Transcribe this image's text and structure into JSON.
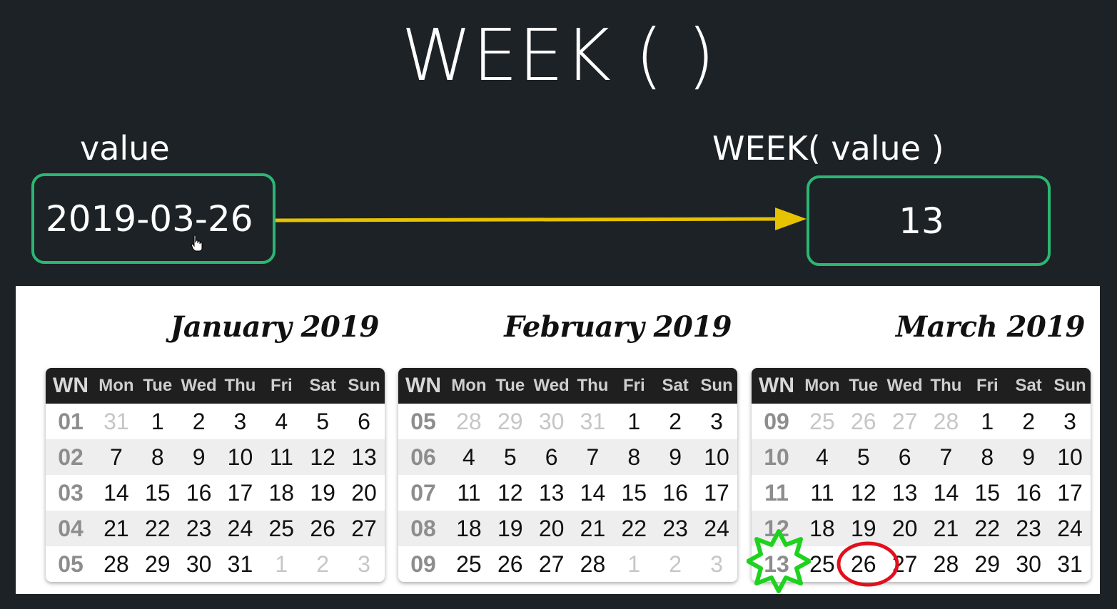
{
  "title": "WEEK ( )",
  "input": {
    "label": "value",
    "value": "2019-03-26"
  },
  "output": {
    "label": "WEEK( value )",
    "value": "13"
  },
  "colors": {
    "box_border": "#2bb673",
    "arrow": "#e6c200",
    "star": "#1ed21e",
    "circle": "#e0101c"
  },
  "calendar": {
    "headers": [
      "WN",
      "Mon",
      "Tue",
      "Wed",
      "Thu",
      "Fri",
      "Sat",
      "Sun"
    ],
    "months": [
      {
        "title": "January 2019",
        "weeks": [
          {
            "wn": "01",
            "days": [
              {
                "d": "31",
                "dim": true
              },
              {
                "d": "1"
              },
              {
                "d": "2"
              },
              {
                "d": "3"
              },
              {
                "d": "4"
              },
              {
                "d": "5"
              },
              {
                "d": "6"
              }
            ]
          },
          {
            "wn": "02",
            "days": [
              {
                "d": "7"
              },
              {
                "d": "8"
              },
              {
                "d": "9"
              },
              {
                "d": "10"
              },
              {
                "d": "11"
              },
              {
                "d": "12"
              },
              {
                "d": "13"
              }
            ]
          },
          {
            "wn": "03",
            "days": [
              {
                "d": "14"
              },
              {
                "d": "15"
              },
              {
                "d": "16"
              },
              {
                "d": "17"
              },
              {
                "d": "18"
              },
              {
                "d": "19"
              },
              {
                "d": "20"
              }
            ]
          },
          {
            "wn": "04",
            "days": [
              {
                "d": "21"
              },
              {
                "d": "22"
              },
              {
                "d": "23"
              },
              {
                "d": "24"
              },
              {
                "d": "25"
              },
              {
                "d": "26"
              },
              {
                "d": "27"
              }
            ]
          },
          {
            "wn": "05",
            "days": [
              {
                "d": "28"
              },
              {
                "d": "29"
              },
              {
                "d": "30"
              },
              {
                "d": "31"
              },
              {
                "d": "1",
                "dim": true
              },
              {
                "d": "2",
                "dim": true
              },
              {
                "d": "3",
                "dim": true
              }
            ]
          }
        ]
      },
      {
        "title": "February 2019",
        "weeks": [
          {
            "wn": "05",
            "days": [
              {
                "d": "28",
                "dim": true
              },
              {
                "d": "29",
                "dim": true
              },
              {
                "d": "30",
                "dim": true
              },
              {
                "d": "31",
                "dim": true
              },
              {
                "d": "1"
              },
              {
                "d": "2"
              },
              {
                "d": "3"
              }
            ]
          },
          {
            "wn": "06",
            "days": [
              {
                "d": "4"
              },
              {
                "d": "5"
              },
              {
                "d": "6"
              },
              {
                "d": "7"
              },
              {
                "d": "8"
              },
              {
                "d": "9"
              },
              {
                "d": "10"
              }
            ]
          },
          {
            "wn": "07",
            "days": [
              {
                "d": "11"
              },
              {
                "d": "12"
              },
              {
                "d": "13"
              },
              {
                "d": "14"
              },
              {
                "d": "15"
              },
              {
                "d": "16"
              },
              {
                "d": "17"
              }
            ]
          },
          {
            "wn": "08",
            "days": [
              {
                "d": "18"
              },
              {
                "d": "19"
              },
              {
                "d": "20"
              },
              {
                "d": "21"
              },
              {
                "d": "22"
              },
              {
                "d": "23"
              },
              {
                "d": "24"
              }
            ]
          },
          {
            "wn": "09",
            "days": [
              {
                "d": "25"
              },
              {
                "d": "26"
              },
              {
                "d": "27"
              },
              {
                "d": "28"
              },
              {
                "d": "1",
                "dim": true
              },
              {
                "d": "2",
                "dim": true
              },
              {
                "d": "3",
                "dim": true
              }
            ]
          }
        ]
      },
      {
        "title": "March 2019",
        "weeks": [
          {
            "wn": "09",
            "days": [
              {
                "d": "25",
                "dim": true
              },
              {
                "d": "26",
                "dim": true
              },
              {
                "d": "27",
                "dim": true
              },
              {
                "d": "28",
                "dim": true
              },
              {
                "d": "1"
              },
              {
                "d": "2"
              },
              {
                "d": "3"
              }
            ]
          },
          {
            "wn": "10",
            "days": [
              {
                "d": "4"
              },
              {
                "d": "5"
              },
              {
                "d": "6"
              },
              {
                "d": "7"
              },
              {
                "d": "8"
              },
              {
                "d": "9"
              },
              {
                "d": "10"
              }
            ]
          },
          {
            "wn": "11",
            "days": [
              {
                "d": "11"
              },
              {
                "d": "12"
              },
              {
                "d": "13"
              },
              {
                "d": "14"
              },
              {
                "d": "15"
              },
              {
                "d": "16"
              },
              {
                "d": "17"
              }
            ]
          },
          {
            "wn": "12",
            "days": [
              {
                "d": "18"
              },
              {
                "d": "19"
              },
              {
                "d": "20"
              },
              {
                "d": "21"
              },
              {
                "d": "22"
              },
              {
                "d": "23"
              },
              {
                "d": "24"
              }
            ]
          },
          {
            "wn": "13",
            "days": [
              {
                "d": "25"
              },
              {
                "d": "26"
              },
              {
                "d": "27"
              },
              {
                "d": "28"
              },
              {
                "d": "29"
              },
              {
                "d": "30"
              },
              {
                "d": "31"
              }
            ]
          }
        ]
      }
    ]
  }
}
